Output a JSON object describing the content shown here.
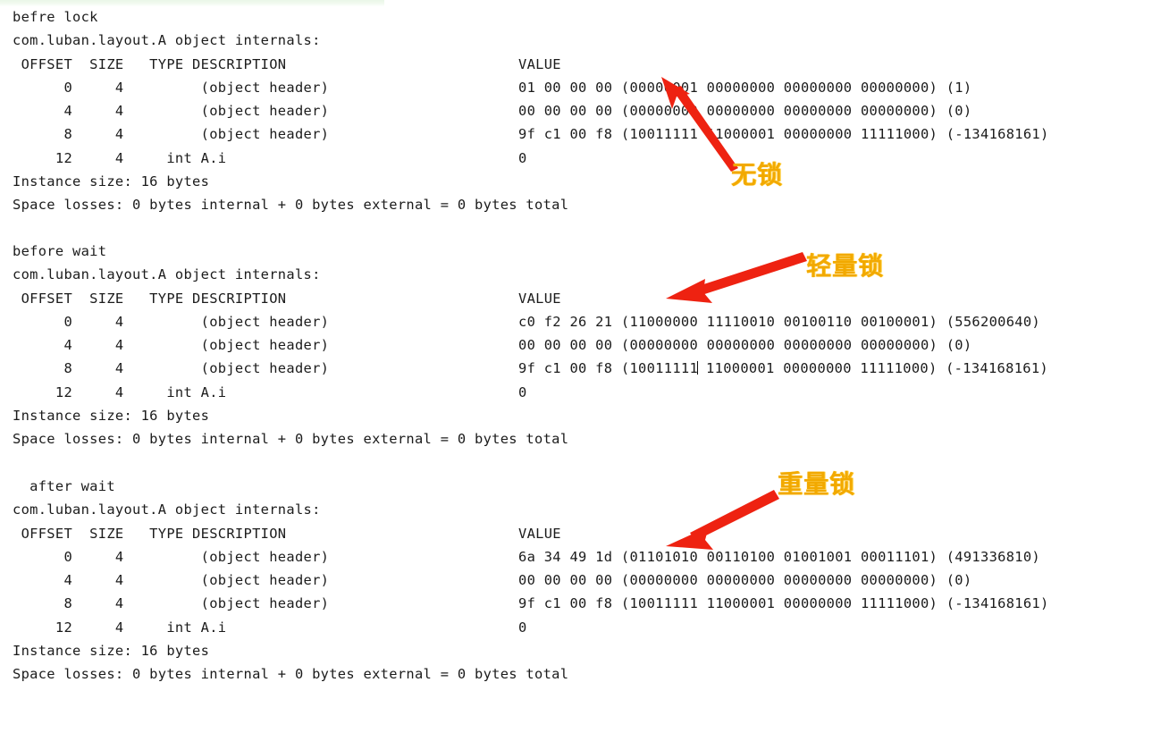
{
  "meta": {
    "accent_annotation_color": "#f2a900",
    "arrow_color": "#ee2211",
    "text_color": "#1b1b1b",
    "background_color": "#ffffff",
    "highlight_band_color": "#eaf6e8"
  },
  "console": {
    "blocks": [
      {
        "id": "block-0",
        "header": "befre lock",
        "class_line": "com.luban.layout.A object internals:",
        "column_header": {
          "left": " OFFSET  SIZE   TYPE DESCRIPTION",
          "value": "VALUE"
        },
        "rows": [
          {
            "left": "      0     4         (object header)",
            "value": "01 00 00 00 (00000001 00000000 00000000 00000000) (1)"
          },
          {
            "left": "      4     4         (object header)",
            "value": "00 00 00 00 (00000000 00000000 00000000 00000000) (0)"
          },
          {
            "left": "      8     4         (object header)",
            "value": "9f c1 00 f8 (10011111 11000001 00000000 11111000) (-134168161)"
          },
          {
            "left": "     12     4     int A.i",
            "value": "0"
          }
        ],
        "instance_size": "Instance size: 16 bytes",
        "space_losses": "Space losses: 0 bytes internal + 0 bytes external = 0 bytes total"
      },
      {
        "id": "block-1",
        "header": "before wait",
        "class_line": "com.luban.layout.A object internals:",
        "column_header": {
          "left": " OFFSET  SIZE   TYPE DESCRIPTION",
          "value": "VALUE"
        },
        "rows": [
          {
            "left": "      0     4         (object header)",
            "value": "c0 f2 26 21 (11000000 11110010 00100110 00100001) (556200640)"
          },
          {
            "left": "      4     4         (object header)",
            "value": "00 00 00 00 (00000000 00000000 00000000 00000000) (0)"
          },
          {
            "left": "      8     4         (object header)",
            "value": "9f c1 00 f8 (10011111 11000001 00000000 11111000) (-134168161)"
          },
          {
            "left": "     12     4     int A.i",
            "value": "0"
          }
        ],
        "instance_size": "Instance size: 16 bytes",
        "space_losses": "Space losses: 0 bytes internal + 0 bytes external = 0 bytes total"
      },
      {
        "id": "block-2",
        "header": "  after wait",
        "class_line": "com.luban.layout.A object internals:",
        "column_header": {
          "left": " OFFSET  SIZE   TYPE DESCRIPTION",
          "value": "VALUE"
        },
        "rows": [
          {
            "left": "      0     4         (object header)",
            "value": "6a 34 49 1d (01101010 00110100 01001001 00011101) (491336810)"
          },
          {
            "left": "      4     4         (object header)",
            "value": "00 00 00 00 (00000000 00000000 00000000 00000000) (0)"
          },
          {
            "left": "      8     4         (object header)",
            "value": "9f c1 00 f8 (10011111 11000001 00000000 11111000) (-134168161)"
          },
          {
            "left": "     12     4     int A.i",
            "value": "0"
          }
        ],
        "instance_size": "Instance size: 16 bytes",
        "space_losses": "Space losses: 0 bytes internal + 0 bytes external = 0 bytes total"
      }
    ]
  },
  "annotations": [
    {
      "id": "cn-label-0",
      "text": "无锁",
      "meaning": "no-lock"
    },
    {
      "id": "cn-label-1",
      "text": "轻量锁",
      "meaning": "lightweight-lock"
    },
    {
      "id": "cn-label-2",
      "text": "重量锁",
      "meaning": "heavyweight-lock"
    }
  ]
}
